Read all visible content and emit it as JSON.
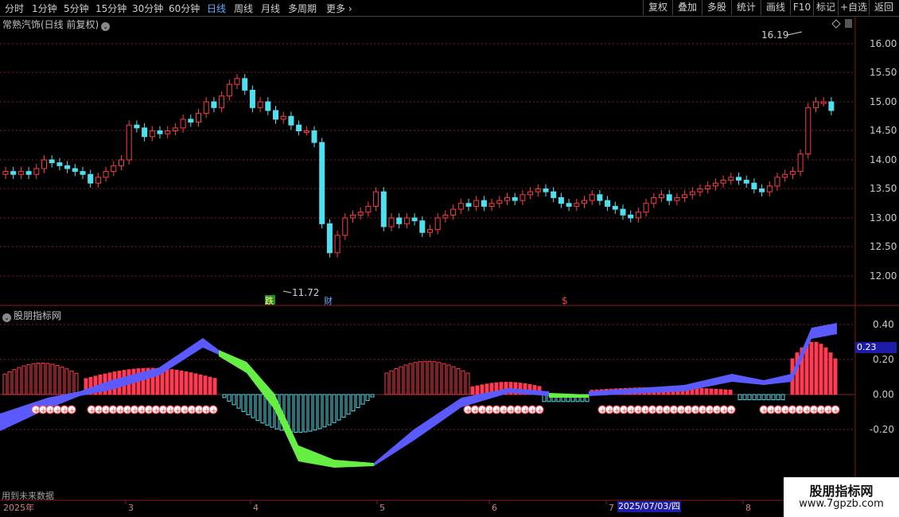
{
  "toolbar": {
    "periods": [
      "分时",
      "1分钟",
      "5分钟",
      "15分钟",
      "30分钟",
      "60分钟",
      "日线",
      "周线",
      "月线",
      "多周期",
      "更多"
    ],
    "active_period": "日线",
    "right_buttons": [
      "复权",
      "叠加",
      "多股",
      "统计",
      "画线",
      "F10",
      "标记",
      "+自选",
      "返回"
    ]
  },
  "main": {
    "title": "常熟汽饰(日线 前复权)",
    "price_axis": [
      "16.00",
      "15.50",
      "15.00",
      "14.50",
      "14.00",
      "13.50",
      "13.00",
      "12.50",
      "12.00"
    ],
    "high_label": "16.19",
    "low_label": "11.72",
    "markers": {
      "die": "跌",
      "cai": "财",
      "dollar": "$"
    }
  },
  "indicator": {
    "title": "股朋指标网",
    "axis": [
      "0.40",
      "0.20",
      "0.00",
      "-0.20"
    ],
    "current_value": "0.23",
    "note": "用到未来数据"
  },
  "date_axis": {
    "labels": [
      "2025年",
      "3",
      "4",
      "5",
      "6",
      "7",
      "8"
    ],
    "cursor_date": "2025/07/03/四"
  },
  "watermark": {
    "title": "股朋指标网",
    "url": "www.7gpzb.com"
  },
  "colors": {
    "up": "#ff3b4a",
    "down": "#4fe0f0",
    "bull_band": "#5a5aff",
    "bear_band": "#66ee44",
    "grid": "#8a1a1a"
  }
}
